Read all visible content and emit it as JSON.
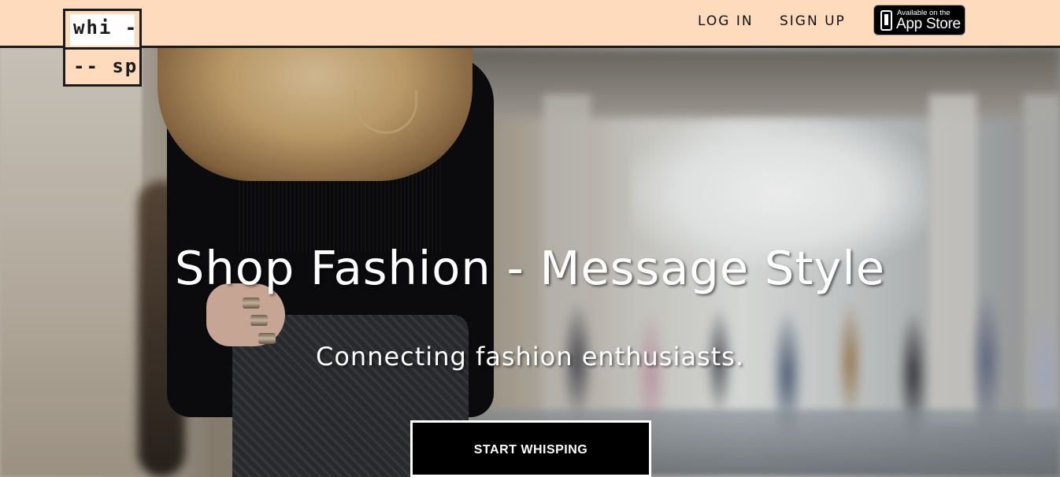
{
  "brand": {
    "logo_line1": "whi -",
    "logo_line2": "-- sp"
  },
  "nav": {
    "login_label": "LOG IN",
    "signup_label": "SIGN UP",
    "appstore": {
      "small_text": "Available on the",
      "big_text": "App Store",
      "icon": "apple-phone-icon"
    }
  },
  "hero": {
    "headline": "Shop Fashion - Message Style",
    "subheadline": "Connecting fashion enthusiasts.",
    "cta_label": "START WHISPING"
  },
  "colors": {
    "header_bg": "#ffdbbd",
    "accent_dark": "#1b1b1b",
    "cta_bg": "#000000",
    "text_light": "#ffffff"
  }
}
